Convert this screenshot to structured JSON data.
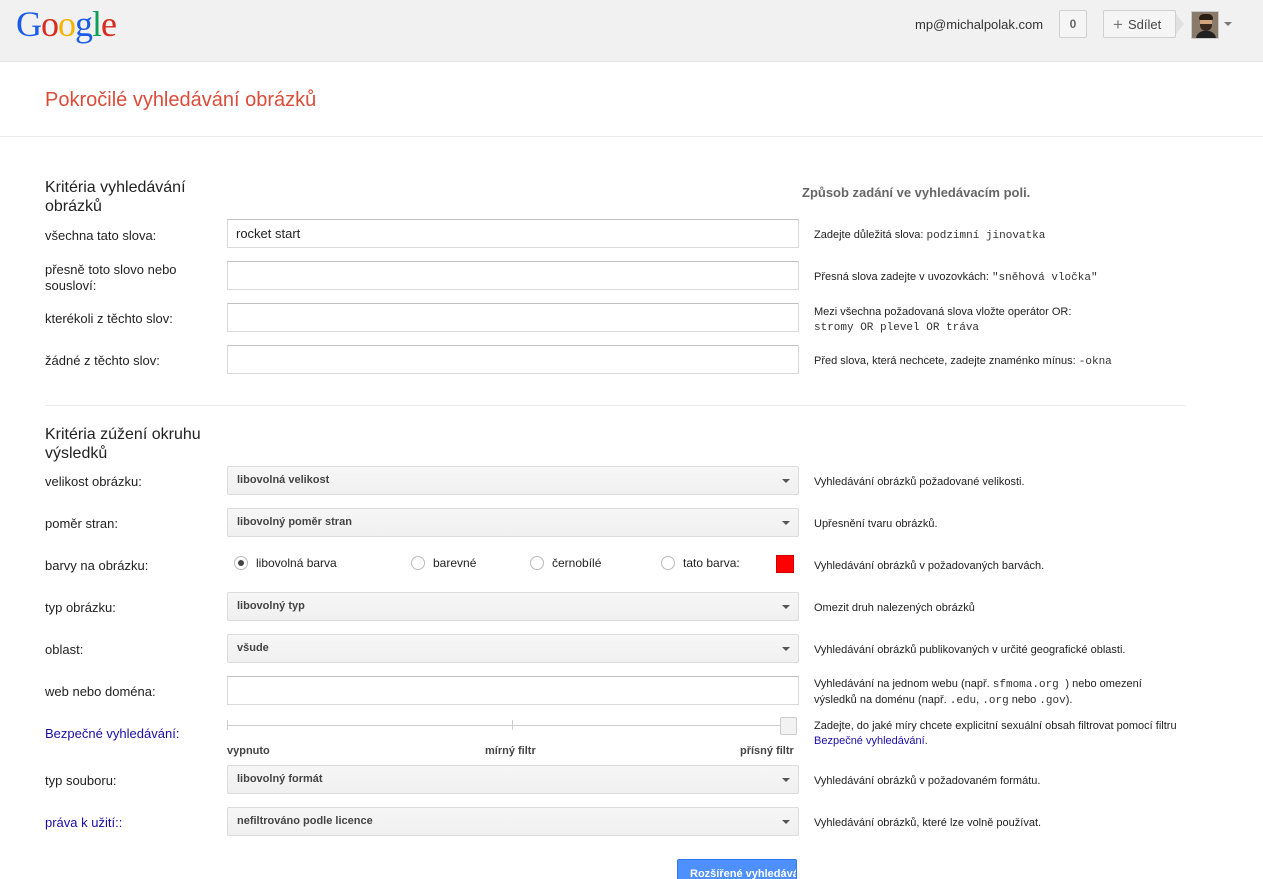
{
  "header": {
    "logo_letters": [
      {
        "ch": "G",
        "color": "#1a5de8"
      },
      {
        "ch": "o",
        "color": "#d72c1e"
      },
      {
        "ch": "o",
        "color": "#f4b400"
      },
      {
        "ch": "g",
        "color": "#1a5de8"
      },
      {
        "ch": "l",
        "color": "#0f9d58"
      },
      {
        "ch": "e",
        "color": "#d72c1e"
      }
    ],
    "email": "mp@michalpolak.com",
    "count": "0",
    "share_label": "Sdílet",
    "share_icon": "plus-icon",
    "avatar_icon": "user-avatar"
  },
  "page_title": "Pokročilé vyhledávání obrázků",
  "search_section": {
    "title": "Kritéria vyhledávání obrázků",
    "hint_title": "Způsob zadání ve vyhledávacím poli.",
    "fields": [
      {
        "label": "všechna tato slova:",
        "value": "rocket start",
        "hint_text": "Zadejte důležitá slova: ",
        "hint_code": "podzimní jinovatka"
      },
      {
        "label": "přesně toto slovo nebo sousloví:",
        "value": "",
        "hint_text": "Přesná slova zadejte v uvozovkách: ",
        "hint_code": "\"sněhová vločka\""
      },
      {
        "label": "kterékoli z těchto slov:",
        "value": "",
        "hint_text": "Mezi všechna požadovaná slova vložte operátor OR:",
        "hint_code": "stromy OR plevel OR tráva"
      },
      {
        "label": "žádné z těchto slov:",
        "value": "",
        "hint_text": "Před slova, která nechcete, zadejte znaménko mínus: ",
        "hint_code": "-okna"
      }
    ]
  },
  "narrow_section": {
    "title": "Kritéria zúžení okruhu výsledků",
    "size": {
      "label": "velikost obrázku:",
      "selected": "libovolná velikost",
      "hint": "Vyhledávání obrázků požadované velikosti."
    },
    "aspect": {
      "label": "poměr stran:",
      "selected": "libovolný poměr stran",
      "hint": "Upřesnění tvaru obrázků."
    },
    "colors": {
      "label": "barvy na obrázku:",
      "options": [
        "libovolná barva",
        "barevné",
        "černobílé",
        "tato barva:"
      ],
      "selected_index": 0,
      "swatch_color": "#ff0000",
      "hint": "Vyhledávání obrázků v požadovaných barvách."
    },
    "type": {
      "label": "typ obrázku:",
      "selected": "libovolný typ",
      "hint": "Omezit druh nalezených obrázků"
    },
    "region": {
      "label": "oblast:",
      "selected": "všude",
      "hint": "Vyhledávání obrázků publikovaných v určité geografické oblasti."
    },
    "site": {
      "label": "web nebo doména:",
      "value": "",
      "hint_1": "Vyhledávání na jednom webu (např. ",
      "hint_code_1": " sfmoma.org ",
      "hint_2": ") nebo omezení",
      "hint_3": "výsledků na doménu (např. ",
      "hint_code_2": ".edu",
      "hint_4": ", ",
      "hint_code_3": ".org",
      "hint_5": " nebo ",
      "hint_code_4": ".gov",
      "hint_6": ")."
    },
    "safesearch": {
      "label": "Bezpečné vyhledávání:",
      "levels": [
        "vypnuto",
        "mírný filtr",
        "přísný filtr"
      ],
      "selected_index": 2,
      "hint_1": "Zadejte, do jaké míry chcete explicitní sexuální obsah filtrovat pomocí filtru",
      "hint_link": "Bezpečné vyhledávání",
      "hint_2": "."
    },
    "filetype": {
      "label": "typ souboru:",
      "selected": "libovolný formát",
      "hint": "Vyhledávání obrázků v požadovaném formátu."
    },
    "rights": {
      "label": "práva k užití::",
      "selected": "nefiltrováno podle licence",
      "hint": "Vyhledávání obrázků, které lze volně používat."
    }
  },
  "submit_label": "Rozšířené vyhledávání"
}
